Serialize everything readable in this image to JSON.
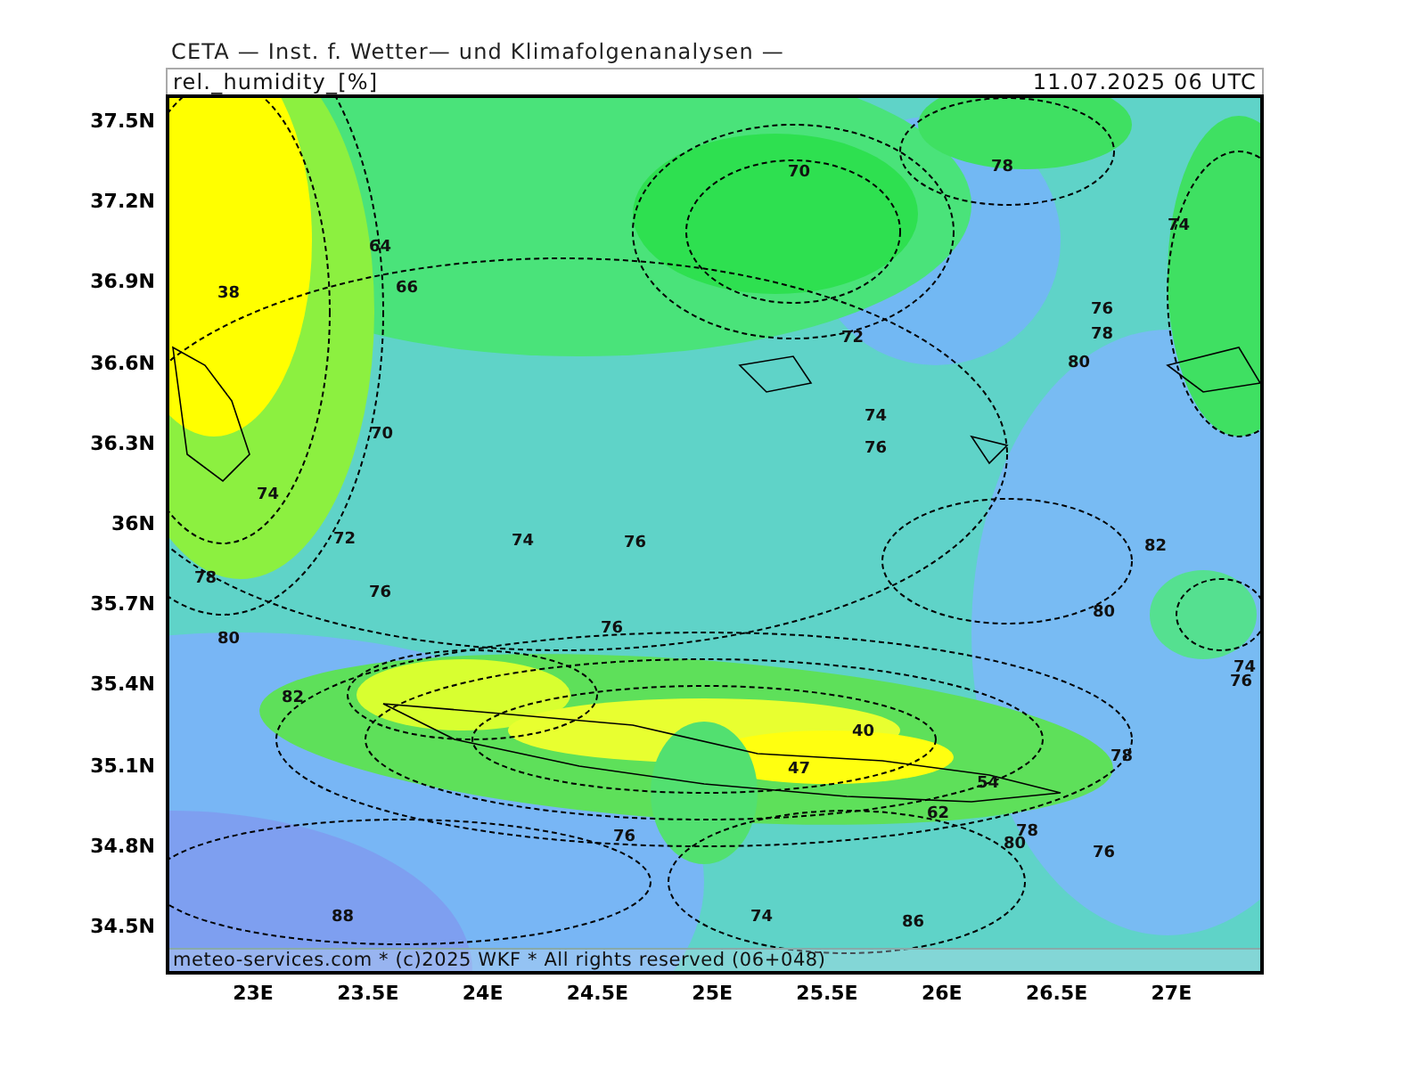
{
  "title": "CETA — Inst. f. Wetter— und Klimafolgenanalysen —",
  "header": {
    "variable": "rel._humidity_[%]",
    "timestamp": "11.07.2025 06 UTC"
  },
  "y_axis_labels": [
    "37.5N",
    "37.2N",
    "36.9N",
    "36.6N",
    "36.3N",
    "36N",
    "35.7N",
    "35.4N",
    "35.1N",
    "34.8N",
    "34.5N"
  ],
  "x_axis_labels": [
    "23E",
    "23.5E",
    "24E",
    "24.5E",
    "25E",
    "25.5E",
    "26E",
    "26.5E",
    "27E"
  ],
  "contour_labels": [
    "38",
    "64",
    "66",
    "70",
    "74",
    "72",
    "74",
    "76",
    "78",
    "80",
    "82",
    "76",
    "76",
    "70",
    "72",
    "74",
    "76",
    "78",
    "74",
    "76",
    "78",
    "80",
    "82",
    "80",
    "74",
    "76",
    "78",
    "76",
    "78",
    "80",
    "76",
    "74",
    "86",
    "88",
    "40",
    "47",
    "54",
    "62"
  ],
  "credit": "meteo-services.com * (c)2025 WKF * All rights reserved (06+048)"
}
